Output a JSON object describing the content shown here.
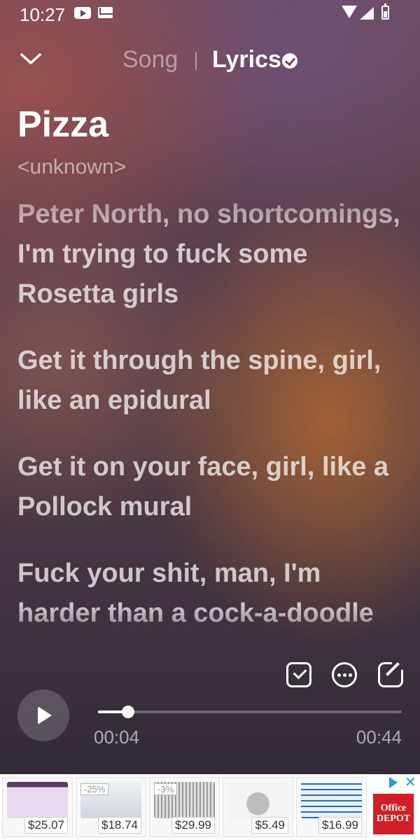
{
  "status_bar": {
    "time": "10:27",
    "icons": [
      "youtube-icon",
      "mail-icon",
      "wifi-icon",
      "signal-icon",
      "battery-icon"
    ]
  },
  "header": {
    "tab_song": "Song",
    "tab_lyrics": "Lyrics",
    "lyrics_verified": true
  },
  "song": {
    "title": "Pizza",
    "artist": "<unknown>"
  },
  "lyrics": [
    "Peter North, no shortcomings, I'm trying to fuck some Rosetta girls",
    "Get it through the spine, girl, like an epidural",
    "Get it on your face, girl, like a Pollock mural",
    "Fuck your shit, man, I'm harder than a cock-a-doodle"
  ],
  "player": {
    "current_time": "00:04",
    "total_time": "00:44",
    "progress_fraction": 0.1
  },
  "ad": {
    "items": [
      {
        "price": "$25.07",
        "discount": ""
      },
      {
        "price": "$18.74",
        "discount": "-25%"
      },
      {
        "price": "$29.99",
        "discount": "-3%"
      },
      {
        "price": "$5.49",
        "discount": ""
      },
      {
        "price": "$16.99",
        "discount": ""
      }
    ],
    "brand_logo": "Office DEPOT"
  }
}
